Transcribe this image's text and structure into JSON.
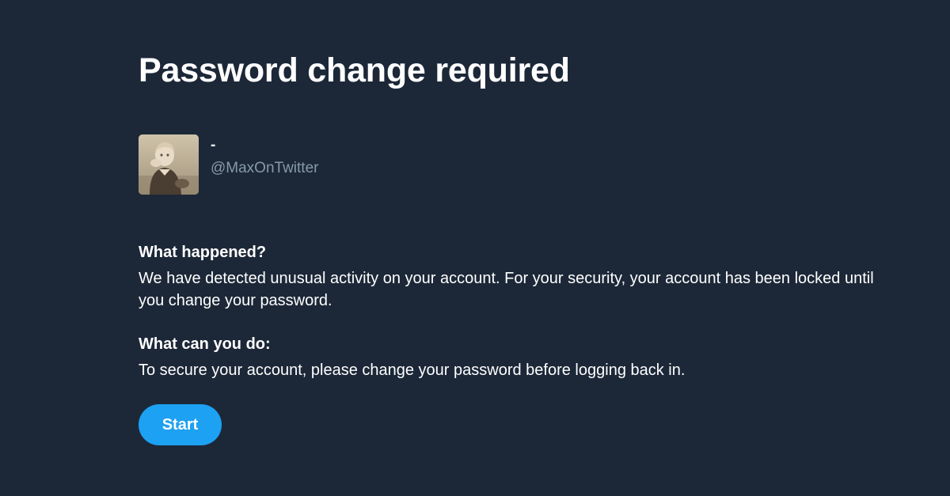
{
  "page": {
    "title": "Password change required"
  },
  "account": {
    "display_name": "-",
    "handle": "@MaxOnTwitter",
    "avatar_icon": "user-photo-avatar"
  },
  "sections": [
    {
      "heading": "What happened?",
      "body": "We have detected unusual activity on your account. For your security, your account has been locked until you change your password."
    },
    {
      "heading": "What can you do:",
      "body": "To secure your account, please change your password before logging back in."
    }
  ],
  "actions": {
    "start_label": "Start"
  },
  "colors": {
    "background": "#1c2838",
    "text": "#ffffff",
    "muted_text": "#8899a6",
    "accent": "#1da1f2"
  }
}
